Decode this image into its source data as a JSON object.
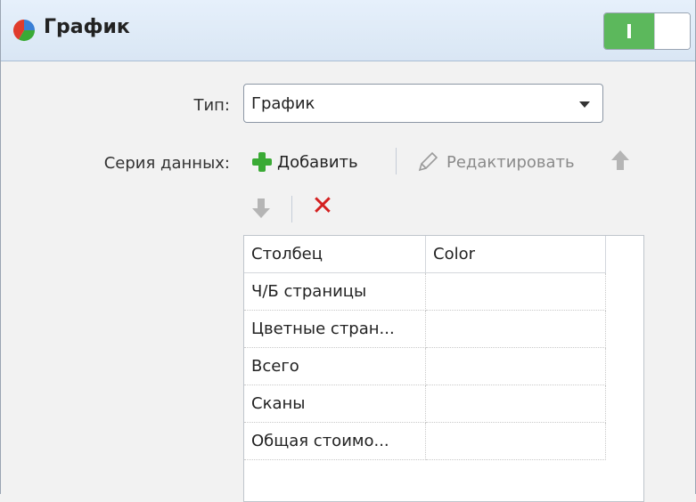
{
  "header": {
    "title": "График",
    "icon": "pie-chart-icon"
  },
  "form": {
    "type_label": "Тип:",
    "type_value": "График",
    "series_label": "Серия данных:"
  },
  "toolbar": {
    "add_label": "Добавить",
    "edit_label": "Редактировать"
  },
  "table": {
    "columns": [
      "Столбец",
      "Color"
    ],
    "rows": [
      {
        "column": "Ч/Б страницы",
        "color": ""
      },
      {
        "column": "Цветные стран...",
        "color": ""
      },
      {
        "column": "Всего",
        "color": ""
      },
      {
        "column": "Сканы",
        "color": ""
      },
      {
        "column": "Общая стоимо...",
        "color": ""
      }
    ]
  },
  "colors": {
    "toggle_on": "#5cb85c",
    "add_green": "#3aaa35",
    "delete_red": "#d42020",
    "header_bg": "#dde8f5"
  }
}
